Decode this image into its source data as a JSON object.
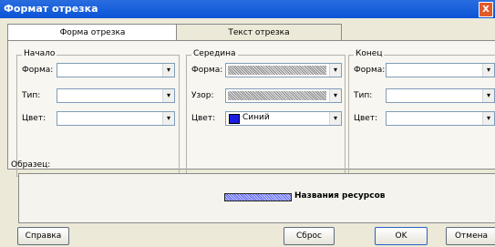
{
  "window": {
    "title": "Формат отрезка",
    "close_label": "X"
  },
  "tabs": [
    {
      "label": "Форма отрезка"
    },
    {
      "label": "Текст отрезка"
    }
  ],
  "groups": {
    "start": {
      "legend": "Начало",
      "rows": [
        {
          "label": "Форма:",
          "value": ""
        },
        {
          "label": "Тип:",
          "value": ""
        },
        {
          "label": "Цвет:",
          "value": ""
        }
      ]
    },
    "middle": {
      "legend": "Середина",
      "rows": [
        {
          "label": "Форма:",
          "value": ""
        },
        {
          "label": "Узор:",
          "value": ""
        },
        {
          "label": "Цвет:",
          "value": "Синий"
        }
      ]
    },
    "end": {
      "legend": "Конец",
      "rows": [
        {
          "label": "Форма:",
          "value": ""
        },
        {
          "label": "Тип:",
          "value": ""
        },
        {
          "label": "Цвет:",
          "value": ""
        }
      ]
    }
  },
  "sample": {
    "label": "Образец:",
    "text": "Названия ресурсов"
  },
  "buttons": {
    "help": "Справка",
    "reset": "Сброс",
    "ok": "OK",
    "cancel": "Отмена"
  },
  "colors": {
    "titlebar": "#0a54d6",
    "sample_bar": "#5b63f4",
    "middle_color_swatch": "#1c1ce0"
  }
}
